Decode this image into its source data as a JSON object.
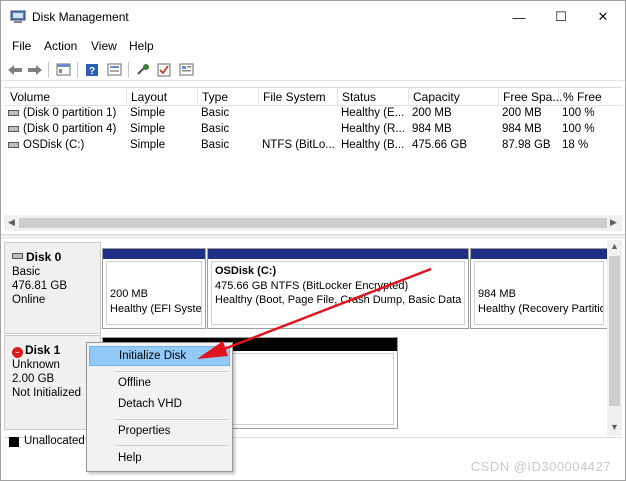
{
  "window": {
    "title": "Disk Management"
  },
  "window_controls": {
    "minimize": "—",
    "maximize": "☐",
    "close": "✕"
  },
  "menubar": {
    "items": [
      "File",
      "Action",
      "View",
      "Help"
    ]
  },
  "toolbar": {
    "buttons": [
      "back-icon",
      "forward-icon",
      "properties-icon",
      "help-icon",
      "refresh-icon",
      "rescan-icon",
      "check-icon",
      "settings-icon"
    ]
  },
  "volume_list": {
    "columns": [
      "Volume",
      "Layout",
      "Type",
      "File System",
      "Status",
      "Capacity",
      "Free Spa...",
      "% Free"
    ],
    "rows": [
      [
        "(Disk 0 partition 1)",
        "Simple",
        "Basic",
        "",
        "Healthy (E...",
        "200 MB",
        "200 MB",
        "100 %"
      ],
      [
        "(Disk 0 partition 4)",
        "Simple",
        "Basic",
        "",
        "Healthy (R...",
        "984 MB",
        "984 MB",
        "100 %"
      ],
      [
        "OSDisk (C:)",
        "Simple",
        "Basic",
        "NTFS (BitLo...",
        "Healthy (B...",
        "475.66 GB",
        "87.98 GB",
        "18 %"
      ]
    ]
  },
  "disks": [
    {
      "name": "Disk 0",
      "type": "Basic",
      "size": "476.81 GB",
      "state": "Online",
      "partitions": [
        {
          "name": "",
          "line1": "200 MB",
          "line2": "Healthy (EFI System Partition)"
        },
        {
          "name": "OSDisk  (C:)",
          "line1": "475.66 GB NTFS (BitLocker Encrypted)",
          "line2": "Healthy (Boot, Page File, Crash Dump, Basic Data Partition)"
        },
        {
          "name": "",
          "line1": "984 MB",
          "line2": "Healthy (Recovery Partition)"
        }
      ]
    },
    {
      "name": "Disk 1",
      "type": "Unknown",
      "size": "2.00 GB",
      "state": "Not Initialized",
      "partitions": [
        {
          "name": "",
          "line1": "",
          "line2": ""
        }
      ]
    }
  ],
  "legend": {
    "unallocated": "Unallocated"
  },
  "context_menu": {
    "items": [
      "Initialize Disk",
      "Offline",
      "Detach VHD",
      "Properties",
      "Help"
    ],
    "highlighted": "Initialize Disk"
  },
  "colors": {
    "partition_bar": "#1f2f86",
    "unallocated_bar": "#000000",
    "highlight": "#91c9f7",
    "arrow": "#e0141e"
  },
  "watermark": "CSDN @ID300004427"
}
